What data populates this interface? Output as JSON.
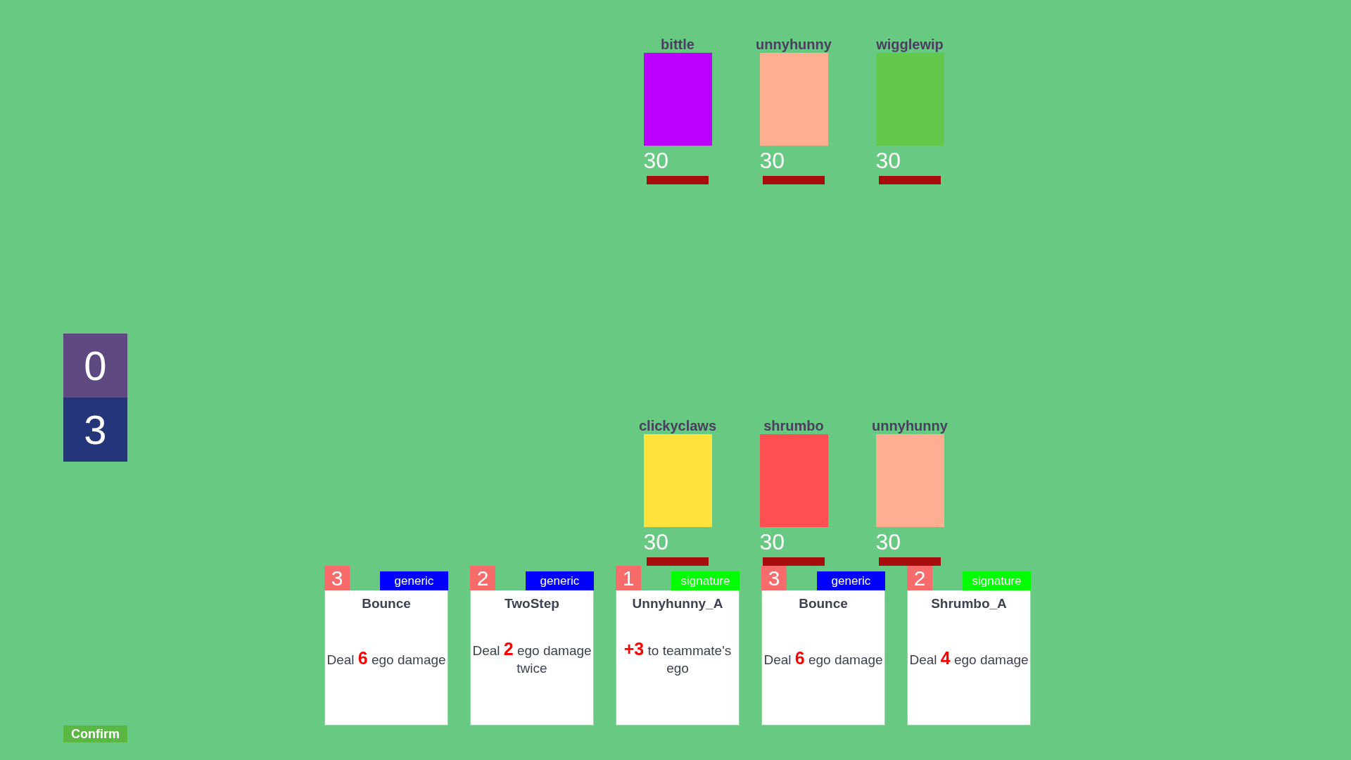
{
  "enemies": [
    {
      "name": "bittle",
      "color": "#bb00ff",
      "hp": "30"
    },
    {
      "name": "unnyhunny",
      "color": "#ffae92",
      "hp": "30"
    },
    {
      "name": "wigglewip",
      "color": "#63c94c",
      "hp": "30"
    }
  ],
  "counters": [
    {
      "value": "0",
      "color": "#5e4a80"
    },
    {
      "value": "3",
      "color": "#24357a"
    }
  ],
  "allies": [
    {
      "name": "clickyclaws",
      "color": "#ffe23b",
      "hp": "30"
    },
    {
      "name": "shrumbo",
      "color": "#ff4f53",
      "hp": "30"
    },
    {
      "name": "unnyhunny",
      "color": "#ffae92",
      "hp": "30"
    }
  ],
  "hand": [
    {
      "cost": "3",
      "tag": "generic",
      "color": "#0000ff",
      "title": "Bounce",
      "text": "Deal **6** ego damage"
    },
    {
      "cost": "2",
      "tag": "generic",
      "color": "#0000ff",
      "title": "TwoStep",
      "text": "Deal **2** ego damage twice"
    },
    {
      "cost": "1",
      "tag": "signature",
      "color": "#00ff00",
      "title": "Unnyhunny_A",
      "text": "**+3** to teammate's ego"
    },
    {
      "cost": "3",
      "tag": "generic",
      "color": "#0000ff",
      "title": "Bounce",
      "text": "Deal **6** ego damage"
    },
    {
      "cost": "2",
      "tag": "signature",
      "color": "#00ff00",
      "title": "Shrumbo_A",
      "text": "Deal **4** ego damage"
    }
  ],
  "confirm_button": {
    "label": "Confirm"
  }
}
